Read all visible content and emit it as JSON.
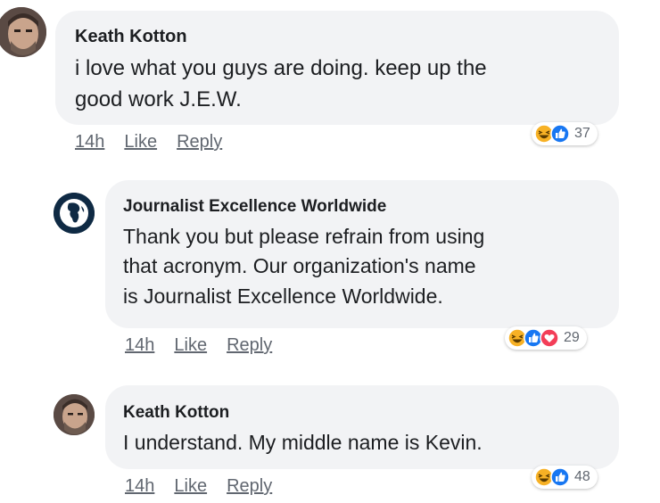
{
  "comments": [
    {
      "author": "Keath Kotton",
      "text_lines": [
        "i love what you guys are doing.  keep up the",
        "good work J.E.W."
      ],
      "time": "14h",
      "like_label": "Like",
      "reply_label": "Reply",
      "reactions": [
        "haha",
        "like"
      ],
      "reaction_count": "37"
    },
    {
      "author": "Journalist Excellence Worldwide",
      "text_lines": [
        "Thank you but please refrain from using",
        "that acronym. Our organization's name",
        "is Journalist Excellence Worldwide."
      ],
      "time": "14h",
      "like_label": "Like",
      "reply_label": "Reply",
      "reactions": [
        "haha",
        "like",
        "love"
      ],
      "reaction_count": "29"
    },
    {
      "author": "Keath Kotton",
      "text_lines": [
        "I understand.  My middle name is Kevin."
      ],
      "time": "14h",
      "like_label": "Like",
      "reply_label": "Reply",
      "reactions": [
        "haha",
        "like"
      ],
      "reaction_count": "48"
    }
  ],
  "colors": {
    "bubble": "#f2f3f5",
    "like_blue": "#1877f2",
    "love_red": "#f33e58",
    "haha_yellow": "#f7b125",
    "action_gray": "#616770"
  }
}
